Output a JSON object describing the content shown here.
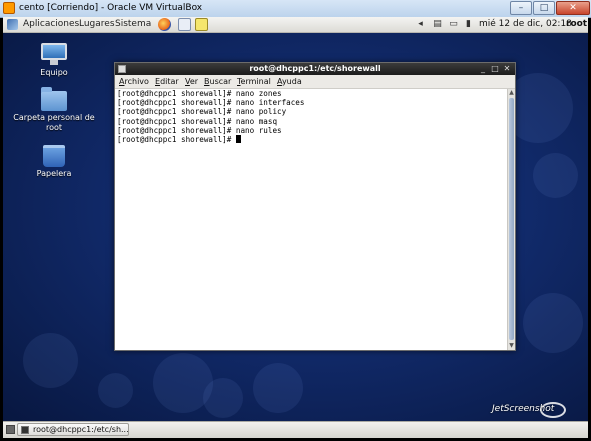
{
  "host_window": {
    "title": "cento [Corriendo] - Oracle VM VirtualBox",
    "minimize_glyph": "–",
    "maximize_glyph": "□",
    "close_glyph": "✕"
  },
  "top_panel": {
    "menus": [
      "Aplicaciones",
      "Lugares",
      "Sistema"
    ],
    "clock": "mié 12 de dic, 02:18",
    "user": "root",
    "tray_icons": [
      "volume-icon",
      "network-icon",
      "keyboard-icon",
      "battery-icon"
    ]
  },
  "desktop": {
    "icons": [
      {
        "label": "Equipo",
        "icon": "computer-icon"
      },
      {
        "label": "Carpeta personal de root",
        "icon": "home-folder-icon"
      },
      {
        "label": "Papelera",
        "icon": "trash-icon"
      }
    ]
  },
  "terminal": {
    "title": "root@dhcppc1:/etc/shorewall",
    "menus": [
      "Archivo",
      "Editar",
      "Ver",
      "Buscar",
      "Terminal",
      "Ayuda"
    ],
    "lines": [
      "[root@dhcppc1 shorewall]# nano zones",
      "[root@dhcppc1 shorewall]# nano interfaces",
      "[root@dhcppc1 shorewall]# nano policy",
      "[root@dhcppc1 shorewall]# nano masq",
      "[root@dhcppc1 shorewall]# nano rules"
    ],
    "prompt": "[root@dhcppc1 shorewall]# "
  },
  "bottom_panel": {
    "task_label": "root@dhcppc1:/etc/sh..."
  },
  "watermark": "JetScreenshot"
}
